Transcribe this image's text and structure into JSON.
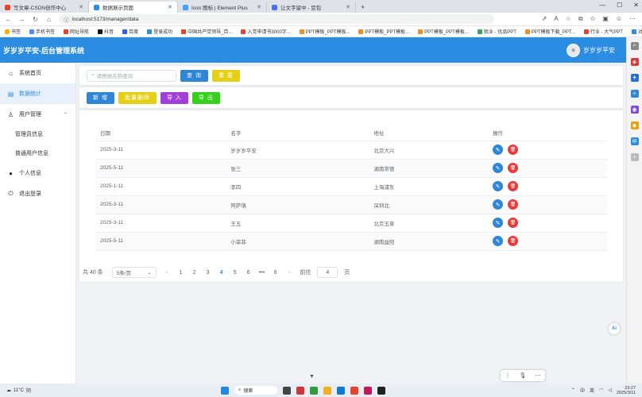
{
  "browser": {
    "tabs": [
      {
        "title": "写文章-CSDN创作中心",
        "color": "#e8412c",
        "active": false
      },
      {
        "title": "数据展示页面",
        "color": "#2a8de1",
        "active": true
      },
      {
        "title": "Icon 图标 | Element Plus",
        "color": "#409eff",
        "active": false
      },
      {
        "title": "让文字留中 - 豆包",
        "color": "#4c6ef5",
        "active": false
      }
    ],
    "new_tab": "+",
    "url": "localhost:5173/manager/data",
    "bookmarks": [
      {
        "label": "书签",
        "color": "#f5b400"
      },
      {
        "label": "手机书签",
        "color": "#4e8ef7"
      },
      {
        "label": "网址导航",
        "color": "#e8412c"
      },
      {
        "label": "抖音",
        "color": "#111111"
      },
      {
        "label": "百度",
        "color": "#3060e0"
      },
      {
        "label": "登录成功",
        "color": "#2a8de1"
      },
      {
        "label": "中国共产党领导_百...",
        "color": "#e8412c"
      },
      {
        "label": "入党申请书3000字...",
        "color": "#e8412c"
      },
      {
        "label": "PPT模板_PPT模板...",
        "color": "#f28c28"
      },
      {
        "label": "PPT模板_PPT模板...",
        "color": "#f28c28"
      },
      {
        "label": "PPT模板_PPT模板...",
        "color": "#f28c28"
      },
      {
        "label": "就业 - 优品PPT",
        "color": "#3aa757"
      },
      {
        "label": "PPT模板下载_PPT...",
        "color": "#f28c28"
      },
      {
        "label": "行业 - 大气PPT",
        "color": "#e8412c"
      },
      {
        "label": "对象类型的设计（...",
        "color": "#2a8de1"
      }
    ]
  },
  "app": {
    "title": "岁岁岁平安-后台管理系统",
    "user_name": "岁岁岁平安",
    "colors": {
      "header": "#2a8de1",
      "primary": "#2f86d6",
      "danger": "#ea3b3b"
    }
  },
  "sidebar": {
    "items": [
      {
        "label": "系统首页",
        "icon": "home-icon",
        "active": false
      },
      {
        "label": "数据统计",
        "icon": "chart-icon",
        "active": true
      },
      {
        "label": "用户管理",
        "icon": "user-icon",
        "active": false,
        "expanded": true
      },
      {
        "label": "管理员信息",
        "sub": true
      },
      {
        "label": "普通用户信息",
        "sub": true
      },
      {
        "label": "个人信息",
        "icon": "person-icon",
        "active": false
      },
      {
        "label": "退出登录",
        "icon": "power-icon",
        "active": false
      }
    ]
  },
  "search": {
    "placeholder": "请根据名称查询",
    "search_btn": "查 询",
    "reset_btn": "重 置"
  },
  "actions": {
    "add": "新 增",
    "batch_delete": "批量删除",
    "import": "导 入",
    "export": "导 出"
  },
  "table": {
    "columns": [
      "日期",
      "名字",
      "地址",
      "操作"
    ],
    "rows": [
      {
        "date": "2025-3-11",
        "name": "岁岁岁平安",
        "address": "北京大兴"
      },
      {
        "date": "2025-5-11",
        "name": "张三",
        "address": "湖南常德"
      },
      {
        "date": "2025-1-11",
        "name": "李四",
        "address": "上海浦东"
      },
      {
        "date": "2025-3-11",
        "name": "阿萨填",
        "address": "深圳北"
      },
      {
        "date": "2025-3-11",
        "name": "王五",
        "address": "北京玉泉"
      },
      {
        "date": "2025-5-11",
        "name": "小菲菲",
        "address": "湖南益阳"
      }
    ]
  },
  "pagination": {
    "total": "共 40 条",
    "page_size": "5条/页",
    "pages": [
      "1",
      "2",
      "3",
      "4",
      "5",
      "6",
      "•••",
      "8"
    ],
    "current": "4",
    "goto_label": "前往",
    "goto_value": "4",
    "goto_suffix": "页"
  },
  "taskbar": {
    "weather_temp": "11°C",
    "weather_desc": "阴",
    "search_label": "搜索",
    "lang1": "中",
    "lang2": "英",
    "time": "23:27",
    "date": "2025/3/11"
  }
}
